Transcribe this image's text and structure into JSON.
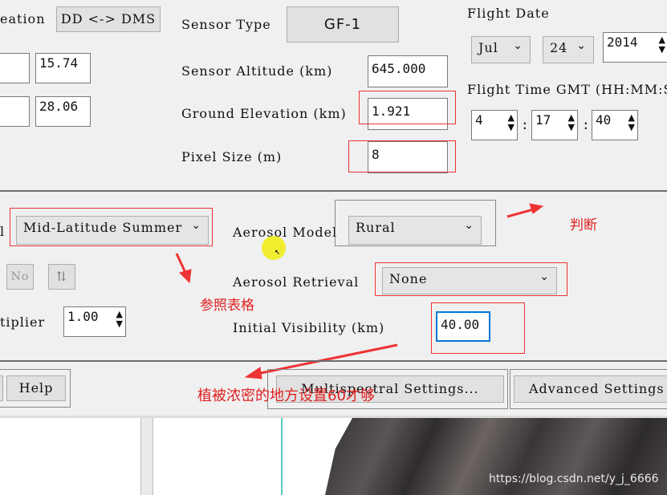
{
  "top": {
    "location_label": "eation",
    "dd_dms_button": "DD <-> DMS",
    "lat_value": "15.74",
    "lon_value": "28.06",
    "sensor_type_label": "Sensor Type",
    "sensor_type_value": "GF-1",
    "sensor_altitude_label": "Sensor Altitude (km)",
    "sensor_altitude_value": "645.000",
    "ground_elevation_label": "Ground Elevation (km)",
    "ground_elevation_value": "1.921",
    "pixel_size_label": "Pixel Size (m)",
    "pixel_size_value": "8",
    "flight_date_label": "Flight Date",
    "month": "Jul",
    "day": "24",
    "year": "2014",
    "flight_time_label": "Flight Time GMT (HH:MM:S",
    "hour": "4",
    "minute": "17",
    "second": "40",
    "sep": ":"
  },
  "middle": {
    "atm_model_label_partial": "l",
    "atm_model_value": "Mid-Latitude Summer",
    "aerosol_model_label": "Aerosol Model",
    "aerosol_model_value": "Rural",
    "aerosol_retrieval_label": "Aerosol Retrieval",
    "aerosol_retrieval_value": "None",
    "no_button": "No",
    "multiplier_label": "tiplier",
    "multiplier_value": "1.00",
    "initial_visibility_label": "Initial Visibility (km)",
    "initial_visibility_value": "40.00"
  },
  "bottom": {
    "help_button": "Help",
    "multispectral_button": "Multispectral Settings...",
    "advanced_button": "Advanced Settings"
  },
  "annotations": {
    "judge": "判断",
    "reference_table": "参照表格",
    "dense_vegetation": "植被浓密的地方设置60才够"
  },
  "watermark": "https://blog.csdn.net/y_j_6666",
  "colors": {
    "annotation_red": "#e02020",
    "focus_blue": "#0078d7"
  }
}
